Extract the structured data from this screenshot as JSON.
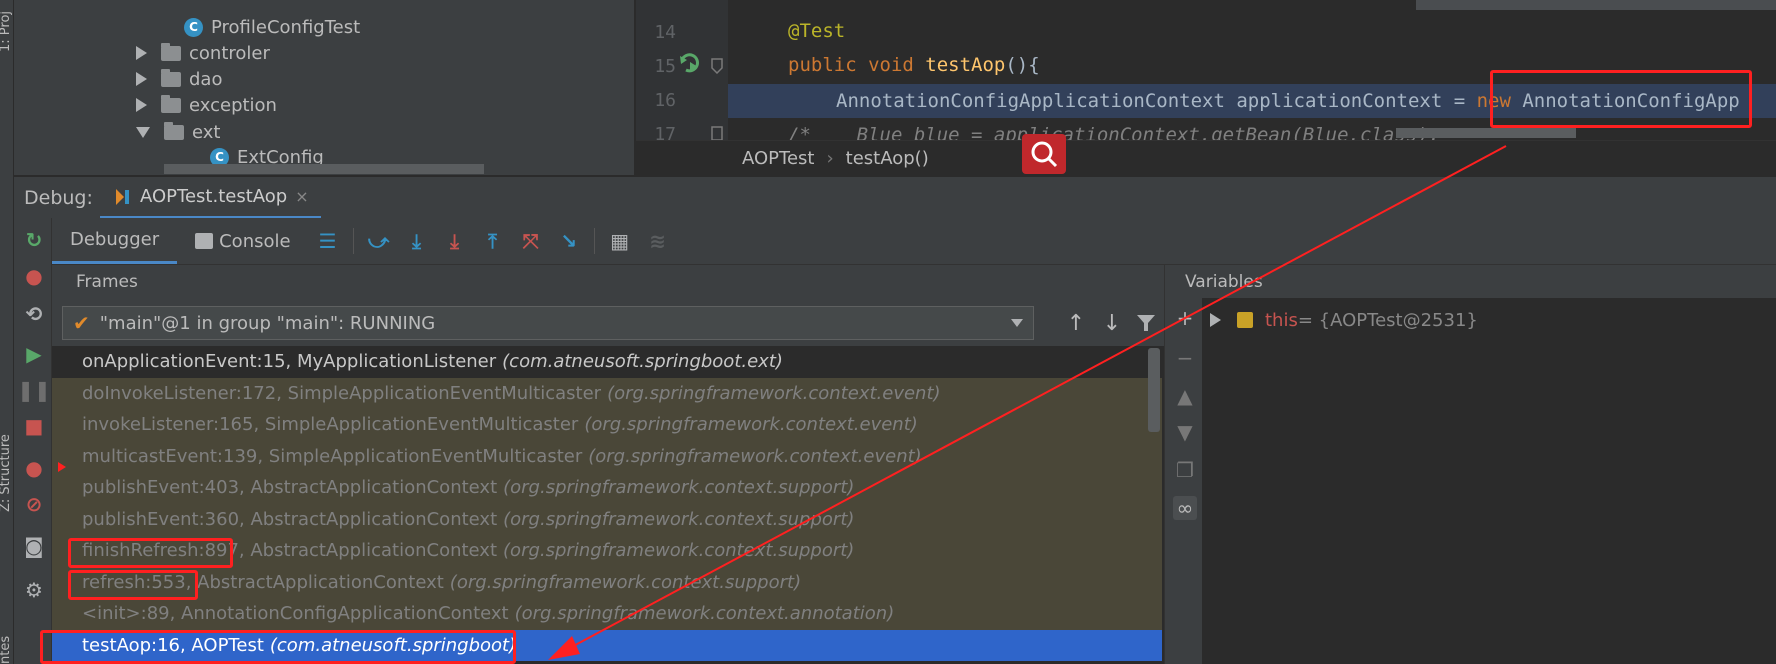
{
  "tool_strip": {
    "top_label": "1: Proj",
    "structure_label": "Z: Structure",
    "bottom_label": "ntes"
  },
  "project_tree": {
    "items": [
      {
        "label": "ProfileConfigTest",
        "kind": "class"
      },
      {
        "label": "controler",
        "kind": "folder",
        "expanded": false
      },
      {
        "label": "dao",
        "kind": "folder",
        "expanded": false
      },
      {
        "label": "exception",
        "kind": "folder",
        "expanded": false
      },
      {
        "label": "ext",
        "kind": "folder",
        "expanded": true
      },
      {
        "label": "ExtConfig",
        "kind": "class"
      }
    ]
  },
  "editor": {
    "lines": [
      {
        "number": "14",
        "code": "@Test"
      },
      {
        "number": "15",
        "code": "public void testAop(){"
      },
      {
        "number": "16",
        "code": "AnnotationConfigApplicationContext applicationContext = new AnnotationConfigApp"
      },
      {
        "number": "17",
        "code": "/*    Blue blue = applicationContext.getBean(Blue.class);"
      }
    ],
    "tokens": {
      "annotation": "@Test",
      "public_void": "public void ",
      "method": "testAop",
      "parens": "(){",
      "type_name": "AnnotationConfigApplicationContext applicationContext = ",
      "new_kw": "new",
      "ctor": " AnnotationConfigApp",
      "comment": "/*    Blue blue = applicationContext.getBean(Blue.class);"
    }
  },
  "breadcrumb": {
    "items": [
      "AOPTest",
      "testAop()"
    ],
    "separator": "›"
  },
  "debug_bar": {
    "label": "Debug:",
    "session_tab": "AOPTest.testAop",
    "close_glyph": "×"
  },
  "toolbar": {
    "tabs": [
      "Debugger",
      "Console"
    ]
  },
  "frames": {
    "header": "Frames",
    "thread": "\"main\"@1 in group \"main\": RUNNING",
    "items": [
      {
        "method": "onApplicationEvent:15, MyApplicationListener",
        "package": "(com.atneusoft.springboot.ext)",
        "style": "top"
      },
      {
        "method": "doInvokeListener:172, SimpleApplicationEventMulticaster",
        "package": "(org.springframework.context.event)",
        "style": "lib"
      },
      {
        "method": "invokeListener:165, SimpleApplicationEventMulticaster",
        "package": "(org.springframework.context.event)",
        "style": "lib"
      },
      {
        "method": "multicastEvent:139, SimpleApplicationEventMulticaster",
        "package": "(org.springframework.context.event)",
        "style": "lib"
      },
      {
        "method": "publishEvent:403, AbstractApplicationContext",
        "package": "(org.springframework.context.support)",
        "style": "lib"
      },
      {
        "method": "publishEvent:360, AbstractApplicationContext",
        "package": "(org.springframework.context.support)",
        "style": "lib"
      },
      {
        "method": "finishRefresh:897, AbstractApplicationContext",
        "package": "(org.springframework.context.support)",
        "style": "lib"
      },
      {
        "method": "refresh:553, AbstractApplicationContext",
        "package": "(org.springframework.context.support)",
        "style": "lib"
      },
      {
        "method": "<init>:89, AnnotationConfigApplicationContext",
        "package": "(org.springframework.context.annotation)",
        "style": "lib"
      },
      {
        "method": "testAop:16, AOPTest",
        "package": "(com.atneusoft.springboot)",
        "style": "sel"
      }
    ]
  },
  "variables": {
    "header": "Variables",
    "items": [
      {
        "name": "this",
        "value": " = {AOPTest@2531}"
      }
    ]
  },
  "colors": {
    "annotation_red": "#ff2020",
    "selection_blue": "#2f65ca",
    "library_frame_bg": "#4a4738"
  }
}
